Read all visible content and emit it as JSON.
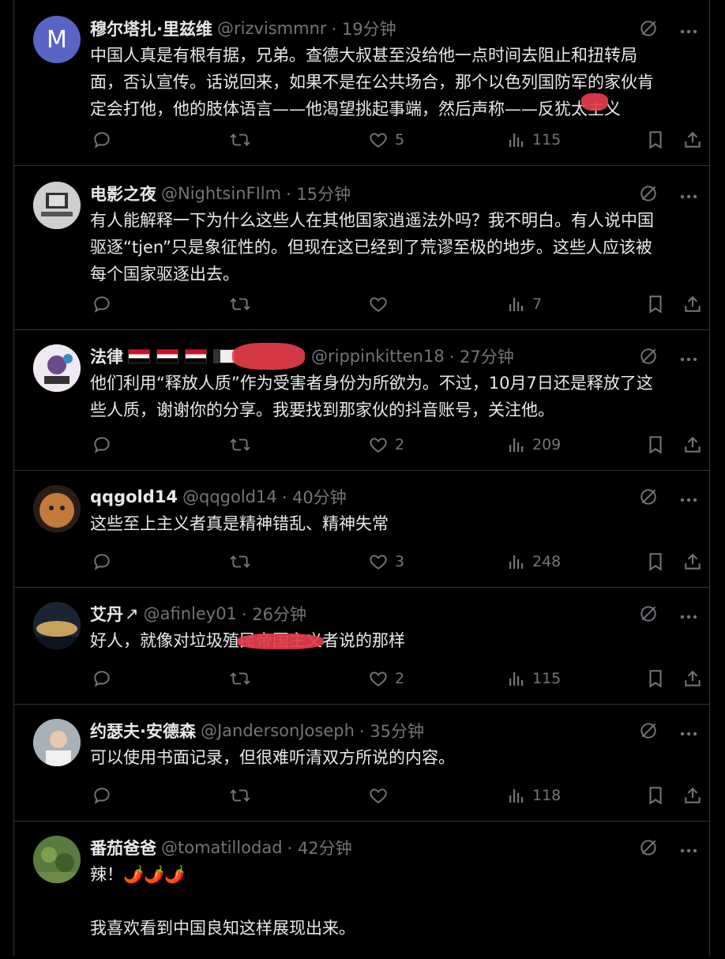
{
  "tweets": [
    {
      "name": "穆尔塔扎·里兹维",
      "handle": "@rizvismmnr",
      "time": "· 19分钟",
      "avatar_letter": "M",
      "lines": [
        "中国人真是有根有据，兄弟。查德大叔甚至没给他一点时间去阻止和扭转局",
        "面，否认宣传。话说回来，如果不是在公共场合，那个以色列国防军的家伙肯",
        "定会打他，他的肢体语言——他渴望挑起事端，然后声称——反犹太主义"
      ],
      "replies": "",
      "retweets": "",
      "likes": "5",
      "views": "115"
    },
    {
      "name": "电影之夜",
      "handle": "@NightsinFIlm",
      "time": "· 15分钟",
      "avatar_letter": "",
      "lines": [
        "有人能解释一下为什么这些人在其他国家逍遥法外吗？我不明白。有人说中国",
        "驱逐“tjen”只是象征性的。但现在这已经到了荒谬至极的地步。这些人应该被",
        "每个国家驱逐出去。"
      ],
      "replies": "",
      "retweets": "",
      "likes": "",
      "views": "7"
    },
    {
      "name": "法律",
      "handle": "@rippinkitten18",
      "time": "· 27分钟",
      "avatar_letter": "",
      "lines": [
        "他们利用“释放人质”作为受害者身份为所欲为。不过，10月7日还是释放了这",
        "些人质，谢谢你的分享。我要找到那家伙的抖音账号，关注他。"
      ],
      "replies": "",
      "retweets": "",
      "likes": "2",
      "views": "209"
    },
    {
      "name": "qqgold14",
      "handle": "@qqgold14",
      "time": "· 40分钟",
      "avatar_letter": "",
      "lines": [
        "这些至上主义者真是精神错乱、精神失常"
      ],
      "replies": "",
      "retweets": "",
      "likes": "3",
      "views": "248"
    },
    {
      "name": "艾丹",
      "handle": "@afinley01",
      "time": "· 26分钟",
      "avatar_letter": "",
      "lines": [
        "好人，就像对垃圾殖民帝国主义者说的那样"
      ],
      "replies": "",
      "retweets": "",
      "likes": "2",
      "views": "115"
    },
    {
      "name": "约瑟夫·安德森",
      "handle": "@JandersonJoseph",
      "time": "· 35分钟",
      "avatar_letter": "",
      "lines": [
        "可以使用书面记录，但很难听清双方所说的内容。"
      ],
      "replies": "",
      "retweets": "",
      "likes": "",
      "views": "118"
    },
    {
      "name": "番茄爸爸",
      "handle": "@tomatillodad",
      "time": "· 42分钟",
      "avatar_letter": "",
      "lines": [
        "辣！🌶️🌶️🌶️",
        "",
        "我喜欢看到中国良知这样展现出来。"
      ],
      "replies": "",
      "retweets": "",
      "likes": "",
      "views": ""
    }
  ],
  "colors": {
    "bg": "#000000",
    "text": "#e7e9ea",
    "muted": "#71767b",
    "border": "#2f3336",
    "avatar_m": "#5865c4"
  },
  "icons": [
    "reply-icon",
    "retweet-icon",
    "like-icon",
    "views-icon",
    "bookmark-icon",
    "share-icon",
    "grok-icon",
    "more-icon"
  ]
}
